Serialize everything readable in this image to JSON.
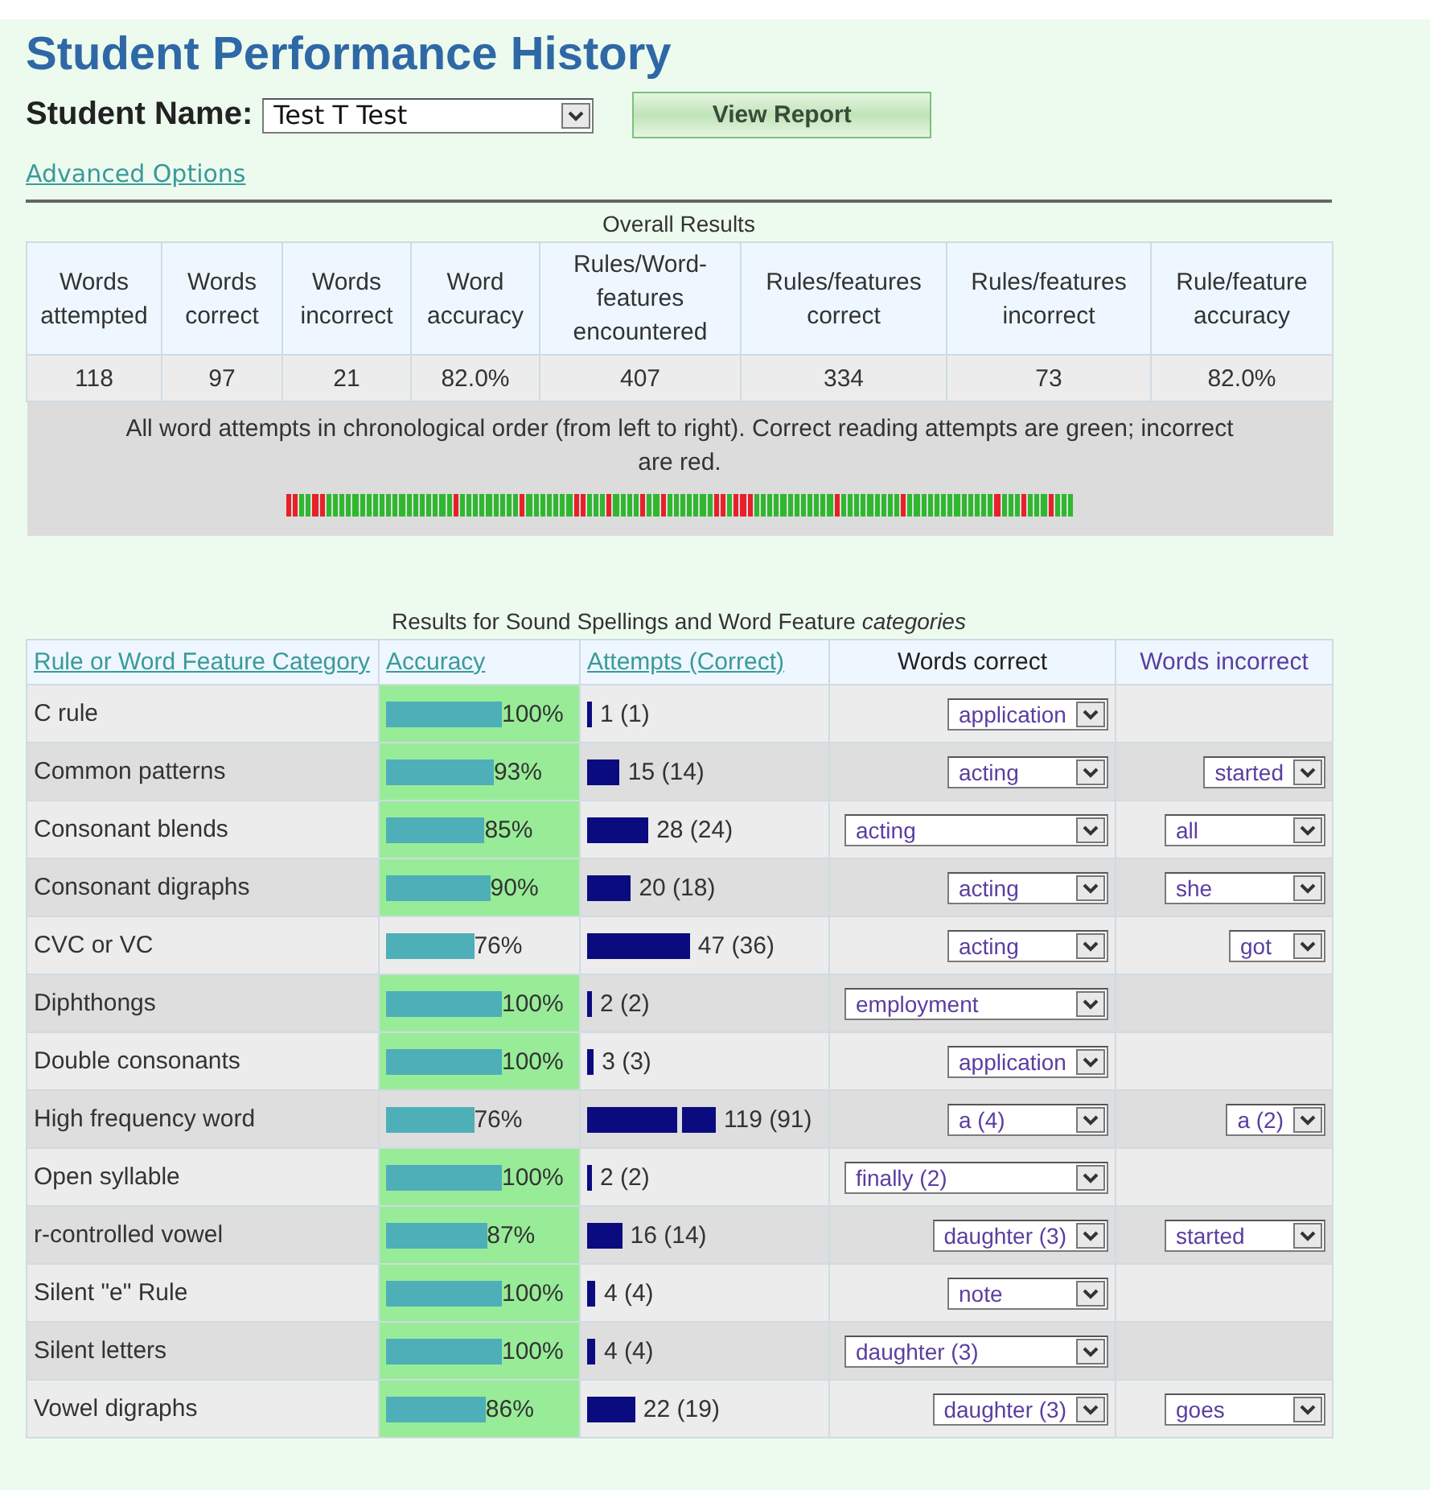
{
  "title": "Student Performance History",
  "student_field": {
    "label": "Student Name:",
    "value": "Test T Test"
  },
  "view_button": "View Report",
  "advanced_link": "Advanced Options",
  "overall": {
    "caption": "Overall Results",
    "columns": [
      "Words attempted",
      "Words correct",
      "Words incorrect",
      "Word accuracy",
      "Rules/Word-features encountered",
      "Rules/features correct",
      "Rules/features incorrect",
      "Rule/feature accuracy"
    ],
    "values": [
      "118",
      "97",
      "21",
      "82.0%",
      "407",
      "334",
      "73",
      "82.0%"
    ],
    "note": "All word attempts in chronological order (from left to right). Correct reading attempts are green; incorrect are red.",
    "attempts": [
      false,
      false,
      true,
      true,
      false,
      false,
      true,
      true,
      true,
      true,
      true,
      true,
      true,
      true,
      true,
      true,
      true,
      true,
      true,
      true,
      true,
      true,
      true,
      true,
      true,
      false,
      true,
      true,
      true,
      true,
      true,
      true,
      true,
      true,
      true,
      false,
      true,
      true,
      true,
      true,
      true,
      true,
      true,
      false,
      false,
      true,
      true,
      true,
      false,
      true,
      true,
      true,
      true,
      false,
      true,
      true,
      false,
      true,
      true,
      true,
      true,
      true,
      true,
      true,
      false,
      false,
      true,
      false,
      false,
      false,
      true,
      true,
      true,
      true,
      true,
      true,
      true,
      true,
      true,
      true,
      true,
      true,
      false,
      true,
      true,
      true,
      true,
      true,
      true,
      true,
      true,
      true,
      false,
      true,
      true,
      true,
      true,
      true,
      true,
      true,
      true,
      true,
      true,
      true,
      true,
      true,
      false,
      true,
      true,
      true,
      false,
      true,
      true,
      true,
      false,
      true,
      true,
      true
    ]
  },
  "categories": {
    "caption": "Results for Sound Spellings and Word Feature *categories*",
    "columns": [
      {
        "label": "Rule or Word Feature Category",
        "kind": "link"
      },
      {
        "label": "Accuracy",
        "kind": "link"
      },
      {
        "label": "Attempts (Correct)",
        "kind": "link"
      },
      {
        "label": "Words correct",
        "kind": "plain"
      },
      {
        "label": "Words incorrect",
        "kind": "accent"
      }
    ],
    "rows": [
      {
        "name": "C rule",
        "accuracy": "100%",
        "passed": true,
        "attempts": "1 (1)",
        "truncated": false,
        "correct_word": "application",
        "incorrect_word": null
      },
      {
        "name": "Common patterns",
        "accuracy": "93%",
        "passed": true,
        "attempts": "15 (14)",
        "truncated": false,
        "correct_word": "acting",
        "incorrect_word": "started"
      },
      {
        "name": "Consonant blends",
        "accuracy": "85%",
        "passed": true,
        "attempts": "28 (24)",
        "truncated": false,
        "correct_word": "acting",
        "incorrect_word": "all"
      },
      {
        "name": "Consonant digraphs",
        "accuracy": "90%",
        "passed": true,
        "attempts": "20 (18)",
        "truncated": false,
        "correct_word": "acting",
        "incorrect_word": "she"
      },
      {
        "name": "CVC or VC",
        "accuracy": "76%",
        "passed": false,
        "attempts": "47 (36)",
        "truncated": false,
        "correct_word": "acting",
        "incorrect_word": "got"
      },
      {
        "name": "Diphthongs",
        "accuracy": "100%",
        "passed": true,
        "attempts": "2 (2)",
        "truncated": false,
        "correct_word": "employment",
        "incorrect_word": null
      },
      {
        "name": "Double consonants",
        "accuracy": "100%",
        "passed": true,
        "attempts": "3 (3)",
        "truncated": false,
        "correct_word": "application",
        "incorrect_word": null
      },
      {
        "name": "High frequency word",
        "accuracy": "76%",
        "passed": false,
        "attempts": "119 (91)",
        "truncated": true,
        "correct_word": "a (4)",
        "incorrect_word": "a (2)"
      },
      {
        "name": "Open syllable",
        "accuracy": "100%",
        "passed": true,
        "attempts": "2 (2)",
        "truncated": false,
        "correct_word": "finally (2)",
        "incorrect_word": null
      },
      {
        "name": "r-controlled vowel",
        "accuracy": "87%",
        "passed": true,
        "attempts": "16 (14)",
        "truncated": false,
        "correct_word": "daughter (3)",
        "incorrect_word": "started"
      },
      {
        "name": "Silent \"e\" Rule",
        "accuracy": "100%",
        "passed": true,
        "attempts": "4 (4)",
        "truncated": false,
        "correct_word": "note",
        "incorrect_word": null
      },
      {
        "name": "Silent letters",
        "accuracy": "100%",
        "passed": true,
        "attempts": "4 (4)",
        "truncated": false,
        "correct_word": "daughter (3)",
        "incorrect_word": null
      },
      {
        "name": "Vowel digraphs",
        "accuracy": "86%",
        "passed": true,
        "attempts": "22 (19)",
        "truncated": false,
        "correct_word": "daughter (3)",
        "incorrect_word": "goes"
      }
    ]
  }
}
